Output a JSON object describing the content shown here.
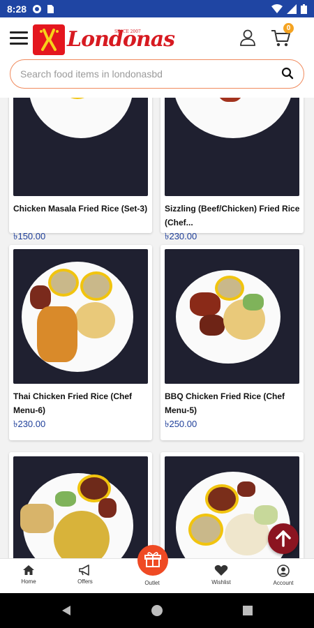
{
  "status": {
    "time": "8:28"
  },
  "header": {
    "logo_text": "Londonas",
    "logo_since": "SINCE 2007",
    "cart_count": "0"
  },
  "search": {
    "placeholder": "Search food items in londonasbd"
  },
  "products": [
    {
      "name": "Chicken Masala Fried Rice (Set-3)",
      "price": "৳150.00"
    },
    {
      "name": "Sizzling (Beef/Chicken) Fried Rice (Chef...",
      "price": "৳230.00"
    },
    {
      "name": "Thai Chicken Fried Rice (Chef Menu-6)",
      "price": "৳230.00"
    },
    {
      "name": "BBQ Chicken Fried Rice (Chef Menu-5)",
      "price": "৳250.00"
    },
    {
      "name": "",
      "price": ""
    },
    {
      "name": "",
      "price": ""
    }
  ],
  "bottom_nav": {
    "home": "Home",
    "offers": "Offers",
    "outlet": "Outlet",
    "wishlist": "Wishlist",
    "account": "Account"
  },
  "colors": {
    "status_bar": "#1f45a3",
    "brand_red": "#e4161e",
    "price_blue": "#1f3f9a",
    "search_border": "#f08a5d",
    "outlet_orange": "#ef4a24",
    "scroll_top_maroon": "#8b1420",
    "cart_badge": "#f4a321"
  }
}
